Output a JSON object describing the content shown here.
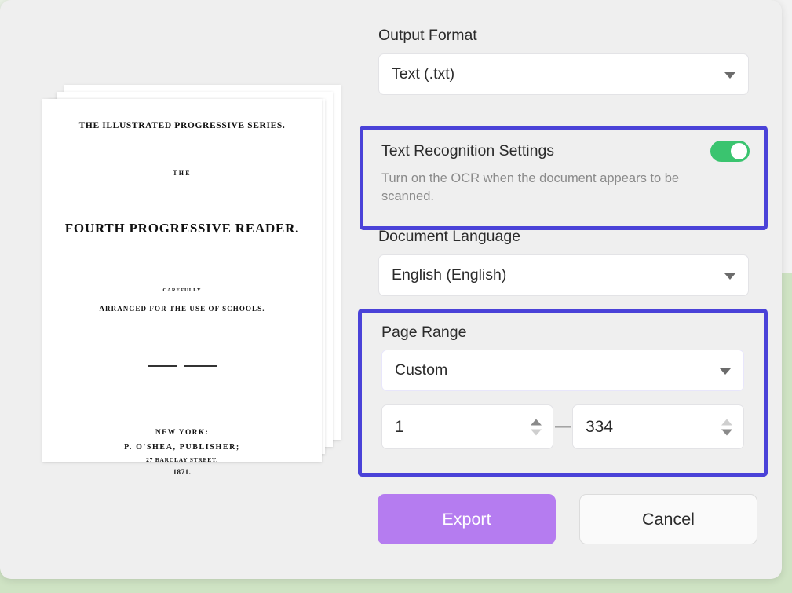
{
  "dialog": {
    "output_format": {
      "label": "Output Format",
      "value": "Text (.txt)"
    },
    "ocr": {
      "title": "Text Recognition Settings",
      "description": "Turn on the OCR when the document appears to be scanned.",
      "toggle_state": "on"
    },
    "document_language": {
      "label": "Document Language",
      "value": "English (English)"
    },
    "page_range": {
      "label": "Page Range",
      "mode": "Custom",
      "from": "1",
      "to": "334",
      "separator": "—"
    },
    "actions": {
      "export_label": "Export",
      "cancel_label": "Cancel"
    }
  },
  "document_preview": {
    "series": "THE ILLUSTRATED PROGRESSIVE SERIES.",
    "the": "THE",
    "title": "FOURTH  PROGRESSIVE  READER.",
    "carefully": "CAREFULLY",
    "arranged": "ARRANGED FOR THE USE OF SCHOOLS.",
    "city": "NEW YORK:",
    "publisher": "P.  O'SHEA,  PUBLISHER;",
    "street": "27 BARCLAY STREET.",
    "year": "1871."
  },
  "colors": {
    "highlight_blue": "#4a42d8",
    "export_purple": "#b57cf0",
    "toggle_green": "#3ac46f",
    "panel_gray": "#efefef",
    "page_background_green": "#cfe3c4"
  }
}
